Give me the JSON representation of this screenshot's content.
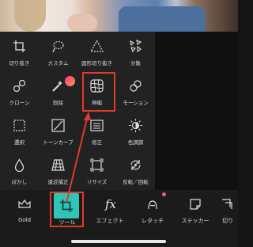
{
  "tools": [
    {
      "label": "切り抜き",
      "icon": "crop-icon"
    },
    {
      "label": "カスタム",
      "icon": "lasso-icon"
    },
    {
      "label": "図形切り抜き",
      "icon": "triangle-icon"
    },
    {
      "label": "分散",
      "icon": "scatter-icon"
    },
    {
      "label": "クローン",
      "icon": "clone-icon"
    },
    {
      "label": "削除",
      "icon": "eraser-icon"
    },
    {
      "label": "伸縮",
      "icon": "stretch-icon"
    },
    {
      "label": "モーション",
      "icon": "motion-icon"
    },
    {
      "label": "選択",
      "icon": "select-icon"
    },
    {
      "label": "トーンカーブ",
      "icon": "curves-icon"
    },
    {
      "label": "修正",
      "icon": "adjust-icon"
    },
    {
      "label": "色調調",
      "icon": "tone-icon"
    },
    {
      "label": "ぼかし",
      "icon": "drop-icon"
    },
    {
      "label": "遠近補正",
      "icon": "perspective-icon"
    },
    {
      "label": "リサイズ",
      "icon": "resize-icon"
    },
    {
      "label": "反転／回転",
      "icon": "flip-rotate-icon"
    }
  ],
  "toolbar": [
    {
      "label": "Gold",
      "icon": "crown-icon"
    },
    {
      "label": "ツール",
      "icon": "crop-tool-icon"
    },
    {
      "label": "エフェクト",
      "icon": "fx-icon"
    },
    {
      "label": "レタッチ",
      "icon": "retouch-icon"
    },
    {
      "label": "ステッカー",
      "icon": "sticker-icon"
    },
    {
      "label": "切り",
      "icon": "cutout-icon"
    }
  ],
  "colors": {
    "accent": "#2ec4b6",
    "highlight": "#e23a2a",
    "badge": "#e85d94"
  }
}
